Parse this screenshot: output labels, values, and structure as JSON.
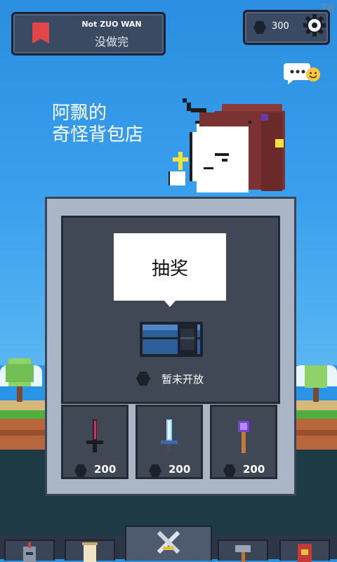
{
  "fps": "76",
  "quest": {
    "top": "Not ZUO WAN",
    "bottom": "没做完",
    "icon": "bookmark-icon"
  },
  "currency": {
    "amount": "300",
    "icon": "hexagon-gem-icon"
  },
  "settings": {
    "icon": "gear-icon"
  },
  "chat": {
    "icon": "chat-bubble-smile-icon"
  },
  "shop_title": {
    "line1": "阿飘的",
    "line2": "奇怪背包店"
  },
  "lottery": {
    "label": "抽奖",
    "status": "暂未开放"
  },
  "items": [
    {
      "name": "dark-dagger",
      "price": "200"
    },
    {
      "name": "ice-sword",
      "price": "200"
    },
    {
      "name": "purple-staff",
      "price": "200"
    }
  ],
  "bottom_tabs": [
    {
      "icon": "knight-helmet-icon",
      "active": false
    },
    {
      "icon": "scroll-icon",
      "active": false
    },
    {
      "icon": "crossed-swords-icon",
      "active": true
    },
    {
      "icon": "hammer-icon",
      "active": false
    },
    {
      "icon": "red-book-icon",
      "active": false
    }
  ],
  "colors": {
    "sky": "#2b8ee0",
    "panel": "#aab6c6",
    "panel_inner": "#3f4854",
    "bookmark": "#e34646"
  }
}
